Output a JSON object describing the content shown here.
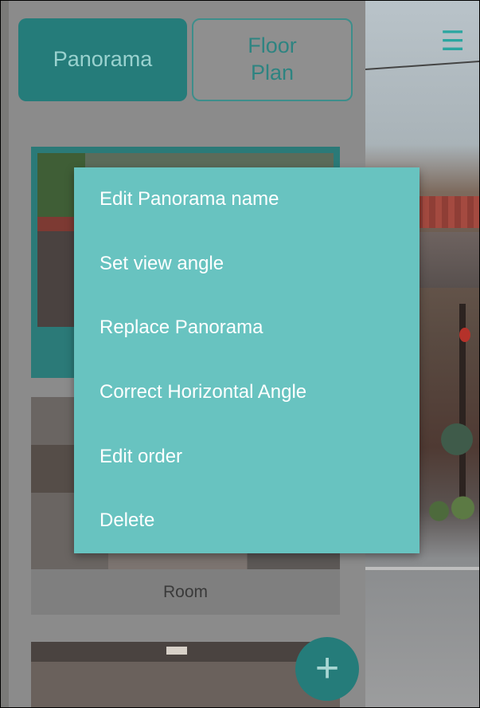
{
  "tabs": {
    "panorama_label": "Panorama",
    "floor_plan_label": "Floor\nPlan"
  },
  "header": {
    "menu_icon": "hamburger-menu-icon"
  },
  "panorama_list": [
    {
      "label": ""
    },
    {
      "label": "Room"
    },
    {
      "label": ""
    }
  ],
  "fab": {
    "icon": "plus-icon",
    "symbol": "+"
  },
  "context_menu": {
    "items": [
      "Edit Panorama name",
      "Set view angle",
      "Replace Panorama",
      "Correct Horizontal Angle",
      "Edit order",
      "Delete"
    ]
  },
  "colors": {
    "accent": "#68c3c0",
    "accent_dark": "#257c7a",
    "menu_text": "#ffffff"
  }
}
